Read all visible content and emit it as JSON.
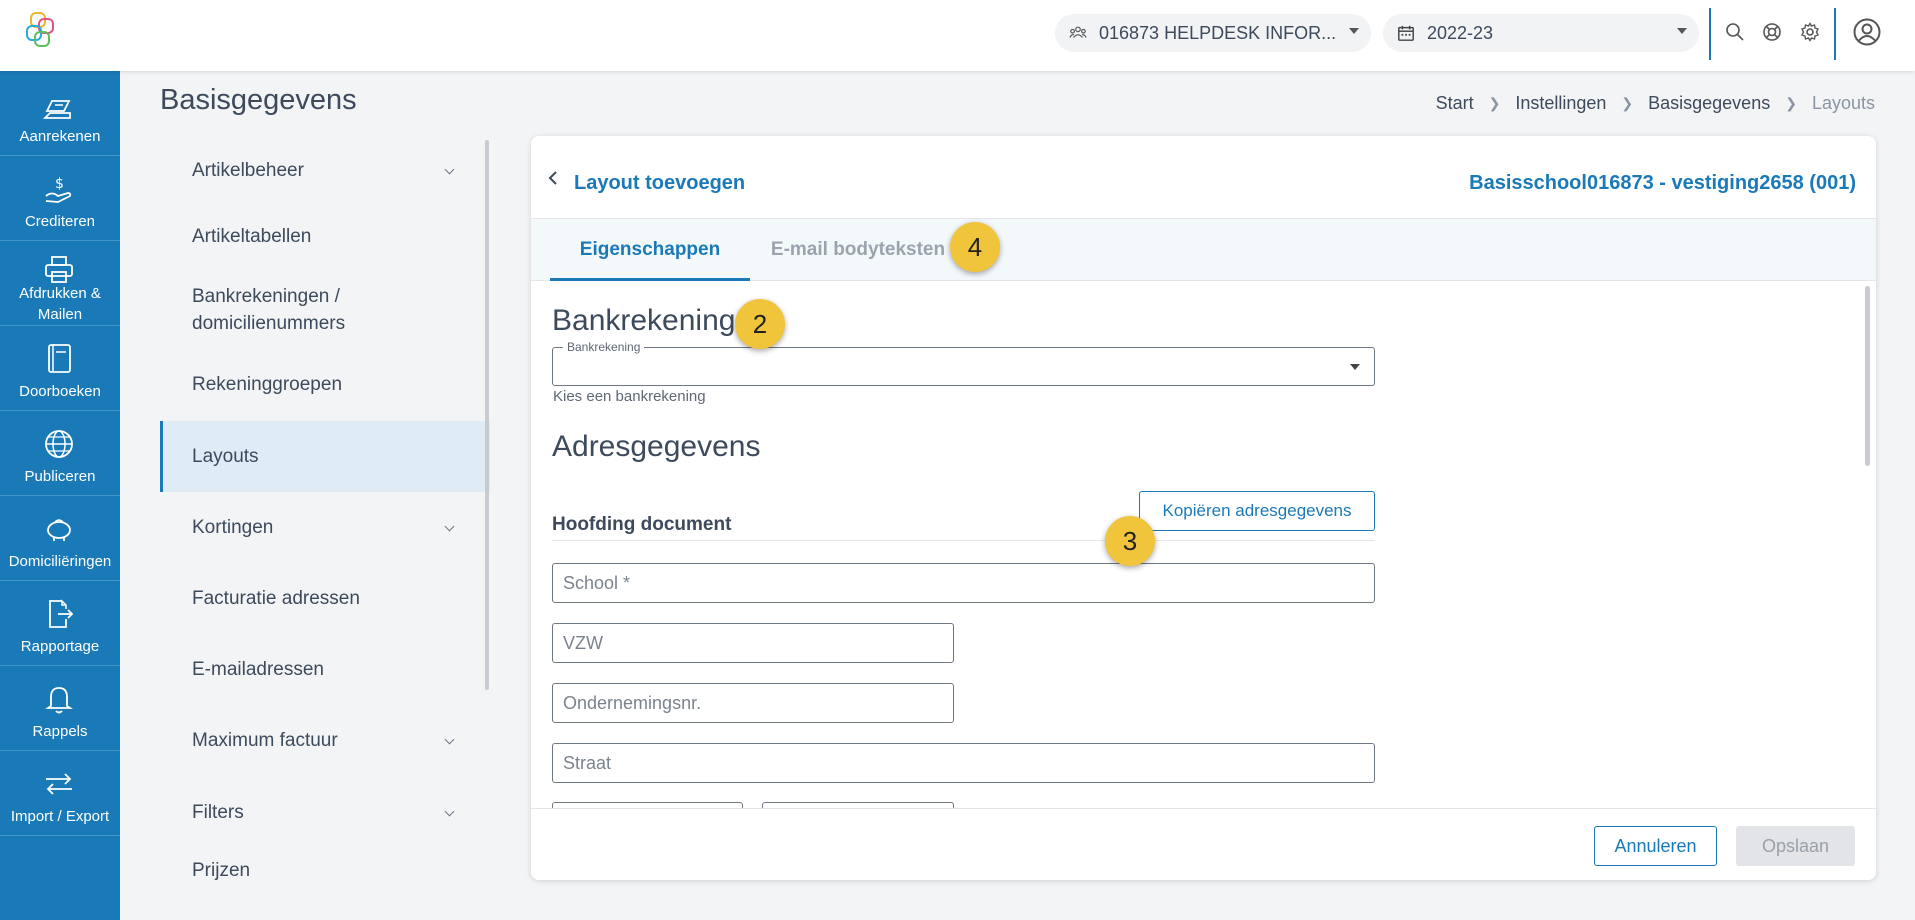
{
  "topbar": {
    "organisation": "016873 HELPDESK INFOR...",
    "school_year": "2022-23"
  },
  "leftnav": {
    "items": [
      {
        "label": "Aanrekenen",
        "icon": "invoice-hand-icon"
      },
      {
        "label": "Crediteren",
        "icon": "money-hand-icon"
      },
      {
        "label": "Afdrukken & Mailen",
        "icon": "printer-icon"
      },
      {
        "label": "Doorboeken",
        "icon": "book-icon"
      },
      {
        "label": "Publiceren",
        "icon": "globe-icon"
      },
      {
        "label": "Domiciliëringen",
        "icon": "piggy-bank-icon"
      },
      {
        "label": "Rapportage",
        "icon": "report-export-icon"
      },
      {
        "label": "Rappels",
        "icon": "bell-icon"
      },
      {
        "label": "Import / Export",
        "icon": "arrows-swap-icon"
      }
    ]
  },
  "page": {
    "title": "Basisgegevens",
    "breadcrumb": [
      "Start",
      "Instellingen",
      "Basisgegevens",
      "Layouts"
    ]
  },
  "submenu": {
    "items": [
      {
        "label": "Artikelbeheer",
        "expandable": true
      },
      {
        "label": "Artikeltabellen",
        "expandable": false
      },
      {
        "label": "Bankrekeningen / domicilienummers",
        "expandable": false
      },
      {
        "label": "Rekeninggroepen",
        "expandable": false
      },
      {
        "label": "Layouts",
        "expandable": false,
        "active": true
      },
      {
        "label": "Kortingen",
        "expandable": true
      },
      {
        "label": "Facturatie adressen",
        "expandable": false
      },
      {
        "label": "E-mailadressen",
        "expandable": false
      },
      {
        "label": "Maximum factuur",
        "expandable": true
      },
      {
        "label": "Filters",
        "expandable": true
      },
      {
        "label": "Prijzen",
        "expandable": false
      }
    ]
  },
  "card": {
    "title": "Layout toevoegen",
    "subtitle": "Basisschool016873 - vestiging2658 (001)",
    "tabs": [
      "Eigenschappen",
      "E-mail bodyteksten"
    ],
    "bank_section": {
      "heading": "Bankrekening",
      "dropdown_label": "Bankrekening",
      "dropdown_value": "",
      "hint": "Kies een bankrekening"
    },
    "address_section": {
      "heading": "Adresgegevens",
      "subheading": "Hoofding document",
      "copy_button": "Kopiëren adresgegevens",
      "fields": {
        "school": "School *",
        "vzw": "VZW",
        "ondernemingsnr": "Ondernemingsnr.",
        "straat": "Straat"
      }
    },
    "footer": {
      "cancel": "Annuleren",
      "save": "Opslaan"
    }
  },
  "markers": [
    "2",
    "3",
    "4"
  ],
  "colors": {
    "primary": "#1a7ab8",
    "marker": "#f0c43b",
    "active_submenu_bg": "#dfebf5"
  }
}
